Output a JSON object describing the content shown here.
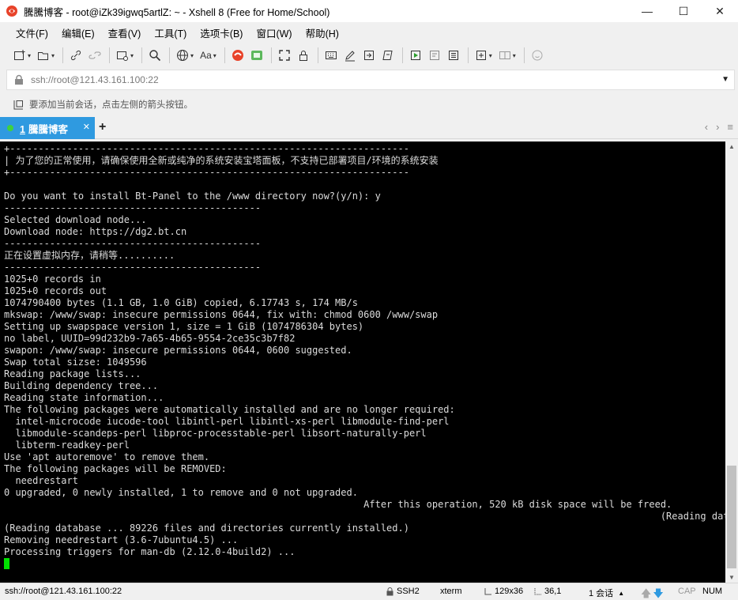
{
  "window": {
    "title": "騰騰博客 - root@iZk39igwq5artlZ: ~ - Xshell 8 (Free for Home/School)",
    "controls": {
      "minimize": "—",
      "maximize": "☐",
      "close": "✕"
    }
  },
  "menu": {
    "items": [
      "文件(F)",
      "编辑(E)",
      "查看(V)",
      "工具(T)",
      "选项卡(B)",
      "窗口(W)",
      "帮助(H)"
    ]
  },
  "toolbar": {
    "font_label": "Aa"
  },
  "address": {
    "value": "ssh://root@121.43.161.100:22"
  },
  "hint": {
    "text": "要添加当前会话，点击左侧的箭头按钮。"
  },
  "tabs": {
    "active": {
      "number": "1",
      "label": "騰騰博客"
    },
    "add": "+",
    "nav_prev": "‹",
    "nav_next": "›"
  },
  "terminal": {
    "lines": [
      "+----------------------------------------------------------------------",
      "| 为了您的正常使用，请确保使用全新或纯净的系统安装宝塔面板，不支持已部署项目/环境的系统安装",
      "+----------------------------------------------------------------------",
      "",
      "Do you want to install Bt-Panel to the /www directory now?(y/n): y",
      "---------------------------------------------",
      "Selected download node...",
      "Download node: https://dg2.bt.cn",
      "---------------------------------------------",
      "正在设置虚拟内存，请稍等..........",
      "---------------------------------------------",
      "1025+0 records in",
      "1025+0 records out",
      "1074790400 bytes (1.1 GB, 1.0 GiB) copied, 6.17743 s, 174 MB/s",
      "mkswap: /www/swap: insecure permissions 0644, fix with: chmod 0600 /www/swap",
      "Setting up swapspace version 1, size = 1 GiB (1074786304 bytes)",
      "no label, UUID=99d232b9-7a65-4b65-9554-2ce35c3b7f82",
      "swapon: /www/swap: insecure permissions 0644, 0600 suggested.",
      "Swap total sizse: 1049596",
      "Reading package lists...",
      "Building dependency tree...",
      "Reading state information...",
      "The following packages were automatically installed and are no longer required:",
      "  intel-microcode iucode-tool libintl-perl libintl-xs-perl libmodule-find-perl",
      "  libmodule-scandeps-perl libproc-processtable-perl libsort-naturally-perl",
      "  libterm-readkey-perl",
      "Use 'apt autoremove' to remove them.",
      "The following packages will be REMOVED:",
      "  needrestart",
      "0 upgraded, 0 newly installed, 1 to remove and 0 not upgraded.",
      "                                                               After this operation, 520 kB disk space will be freed.",
      "                                                                                                                   (Reading data",
      "(Reading database ... 89226 files and directories currently installed.)",
      "Removing needrestart (3.6-7ubuntu4.5) ...",
      "Processing triggers for man-db (2.12.0-4build2) ..."
    ]
  },
  "status": {
    "connection": "ssh://root@121.43.161.100:22",
    "protocol": "SSH2",
    "terminal_type": "xterm",
    "size": "129x36",
    "position": "36,1",
    "sessions": "1 会话",
    "cap": "CAP",
    "num": "NUM"
  },
  "colors": {
    "tab_active": "#2f9ae0",
    "terminal_bg": "#000000",
    "terminal_fg": "#dcdcdc",
    "cursor": "#00e000",
    "tab_dot": "#3fd13f"
  }
}
